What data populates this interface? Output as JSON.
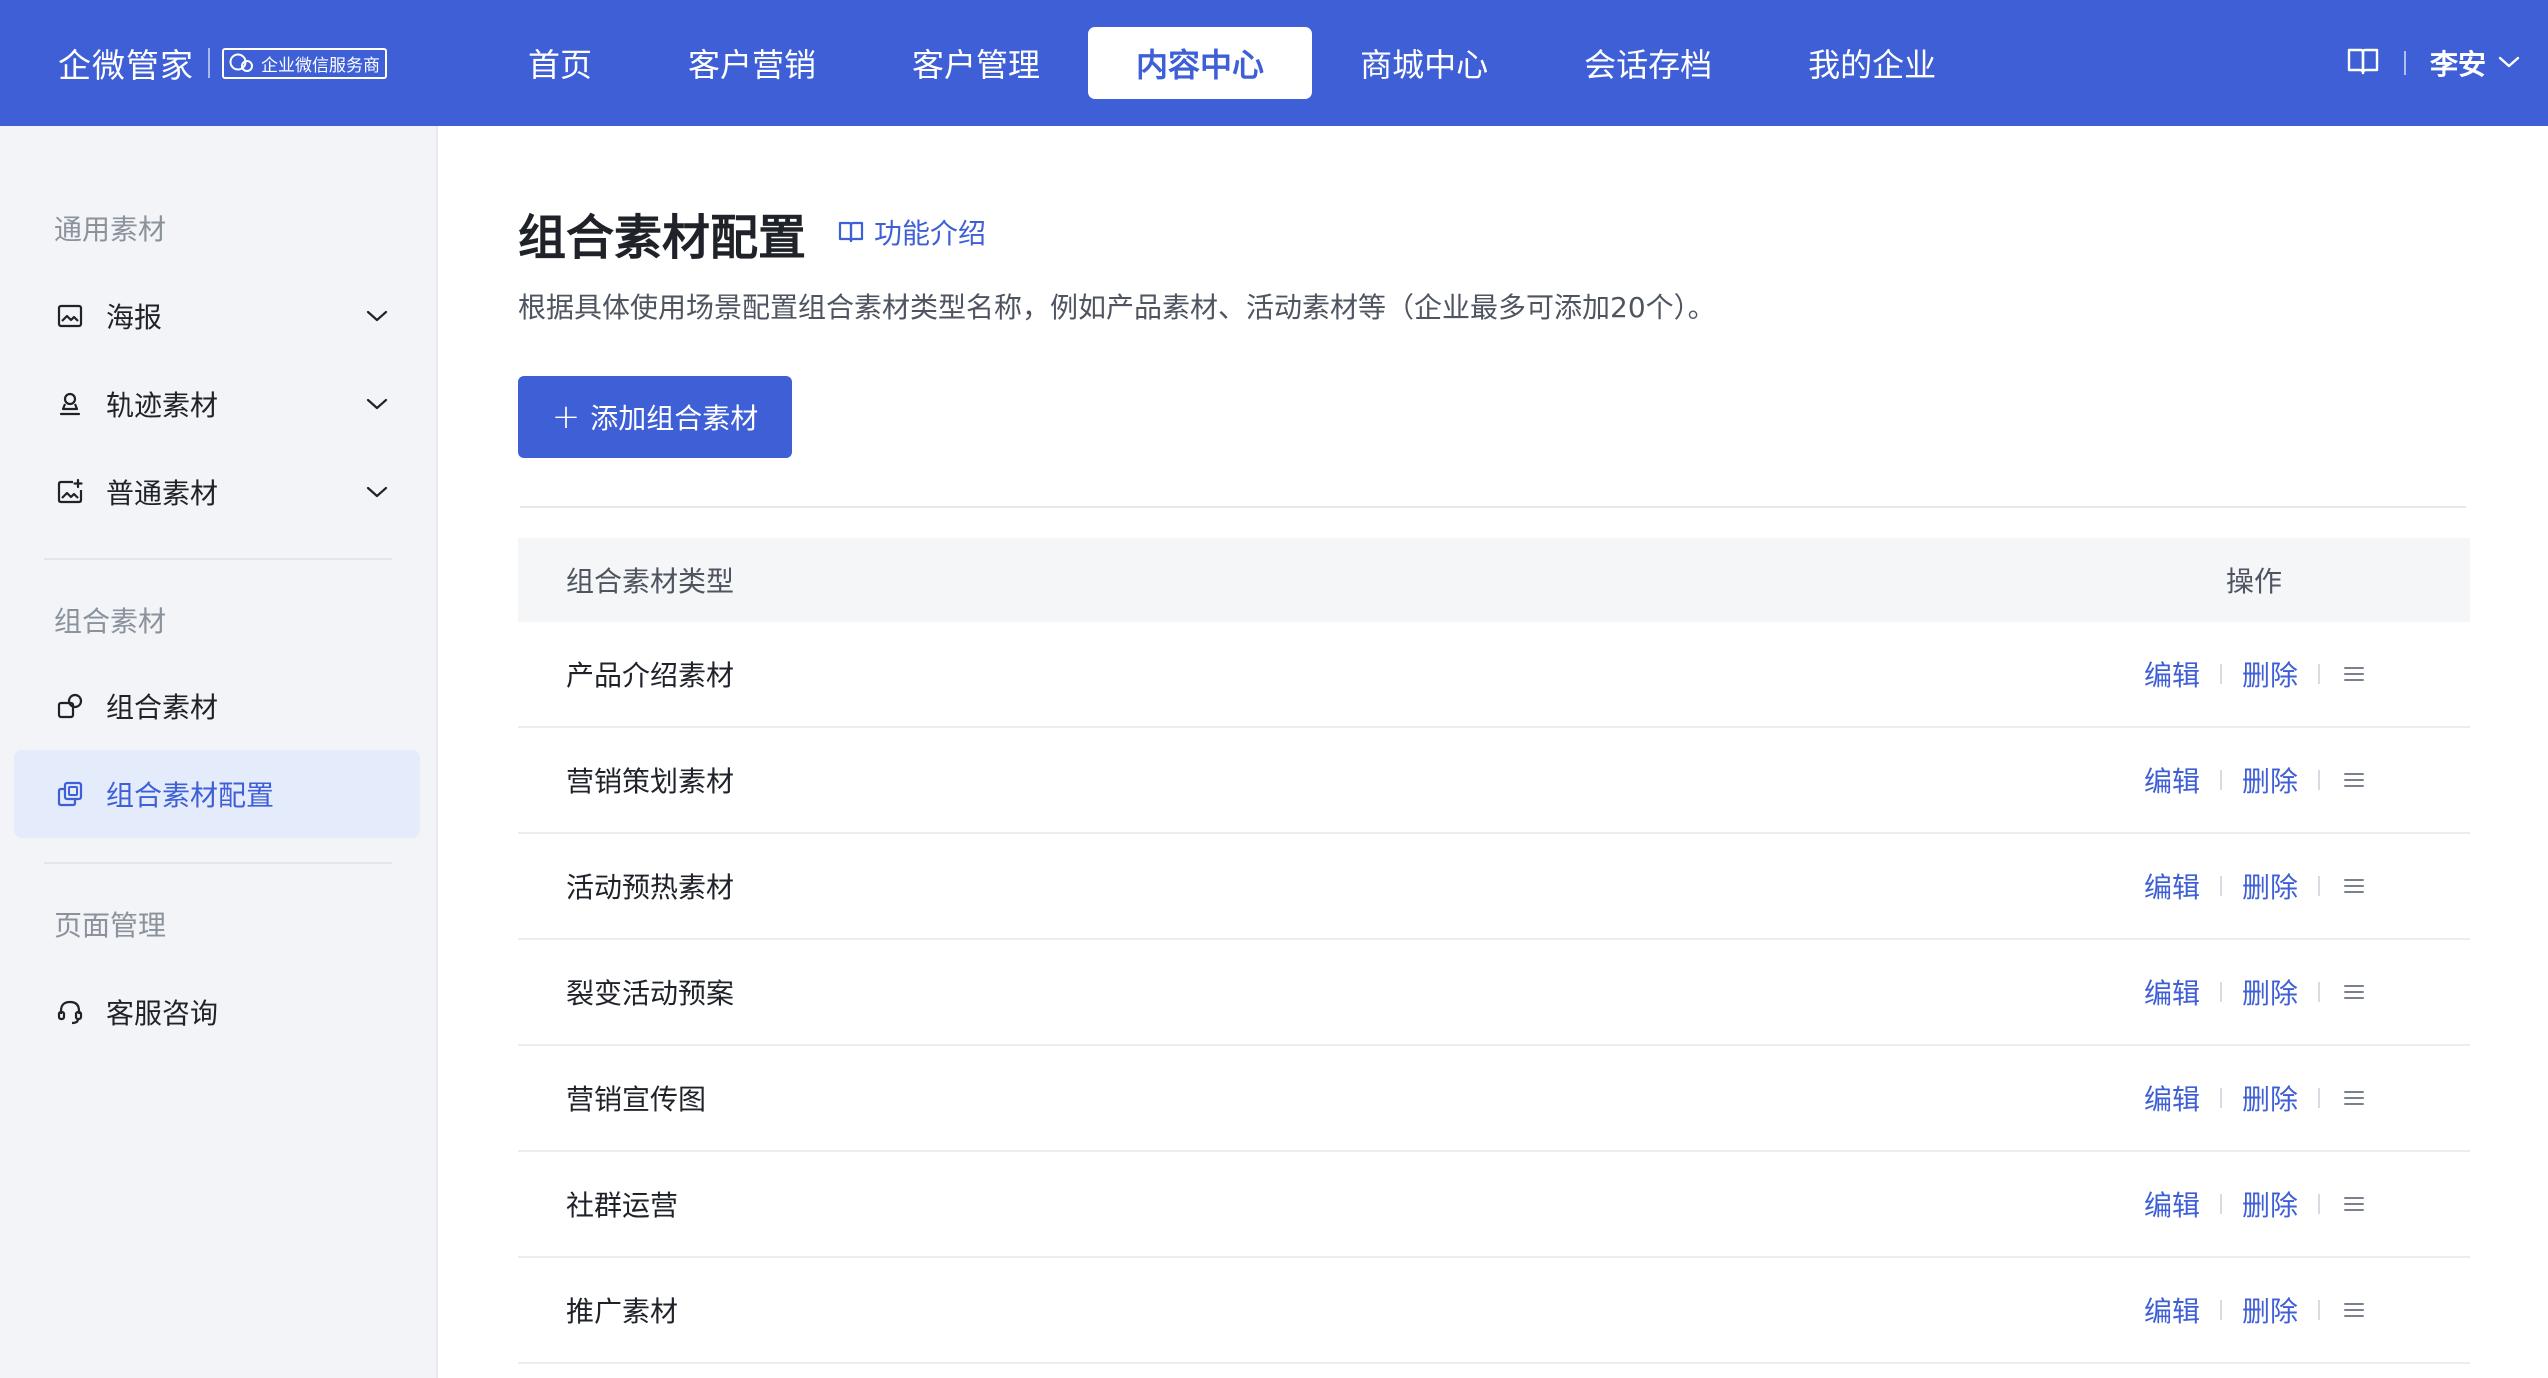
{
  "brand": {
    "name": "企微管家",
    "badge": "企业微信服务商"
  },
  "nav": {
    "items": [
      {
        "label": "首页"
      },
      {
        "label": "客户营销"
      },
      {
        "label": "客户管理"
      },
      {
        "label": "内容中心",
        "active": true
      },
      {
        "label": "商城中心"
      },
      {
        "label": "会话存档"
      },
      {
        "label": "我的企业"
      }
    ]
  },
  "user": {
    "name": "李安"
  },
  "sidebar": {
    "groups": [
      {
        "title": "通用素材",
        "items": [
          {
            "label": "海报",
            "icon": "image-icon"
          },
          {
            "label": "轨迹素材",
            "icon": "stamp-icon"
          },
          {
            "label": "普通素材",
            "icon": "image-plus-icon"
          }
        ]
      },
      {
        "title": "组合素材",
        "items": [
          {
            "label": "组合素材",
            "icon": "combine-icon"
          },
          {
            "label": "组合素材配置",
            "icon": "copy-icon",
            "active": true
          }
        ]
      },
      {
        "title": "页面管理",
        "items": [
          {
            "label": "客服咨询",
            "icon": "headset-icon"
          }
        ]
      }
    ]
  },
  "page": {
    "title": "组合素材配置",
    "intro_link": "功能介绍",
    "description": "根据具体使用场景配置组合素材类型名称，例如产品素材、活动素材等（企业最多可添加20个）。",
    "add_button": "添加组合素材"
  },
  "table": {
    "headers": {
      "type": "组合素材类型",
      "ops": "操作"
    },
    "edit_label": "编辑",
    "delete_label": "删除",
    "rows": [
      {
        "type": "产品介绍素材"
      },
      {
        "type": "营销策划素材"
      },
      {
        "type": "活动预热素材"
      },
      {
        "type": "裂变活动预案"
      },
      {
        "type": "营销宣传图"
      },
      {
        "type": "社群运营"
      },
      {
        "type": "推广素材"
      }
    ]
  },
  "colors": {
    "primary": "#3e5fd6",
    "sidebar_bg": "#f2f4f7",
    "active_bg": "#e4ebfb"
  }
}
